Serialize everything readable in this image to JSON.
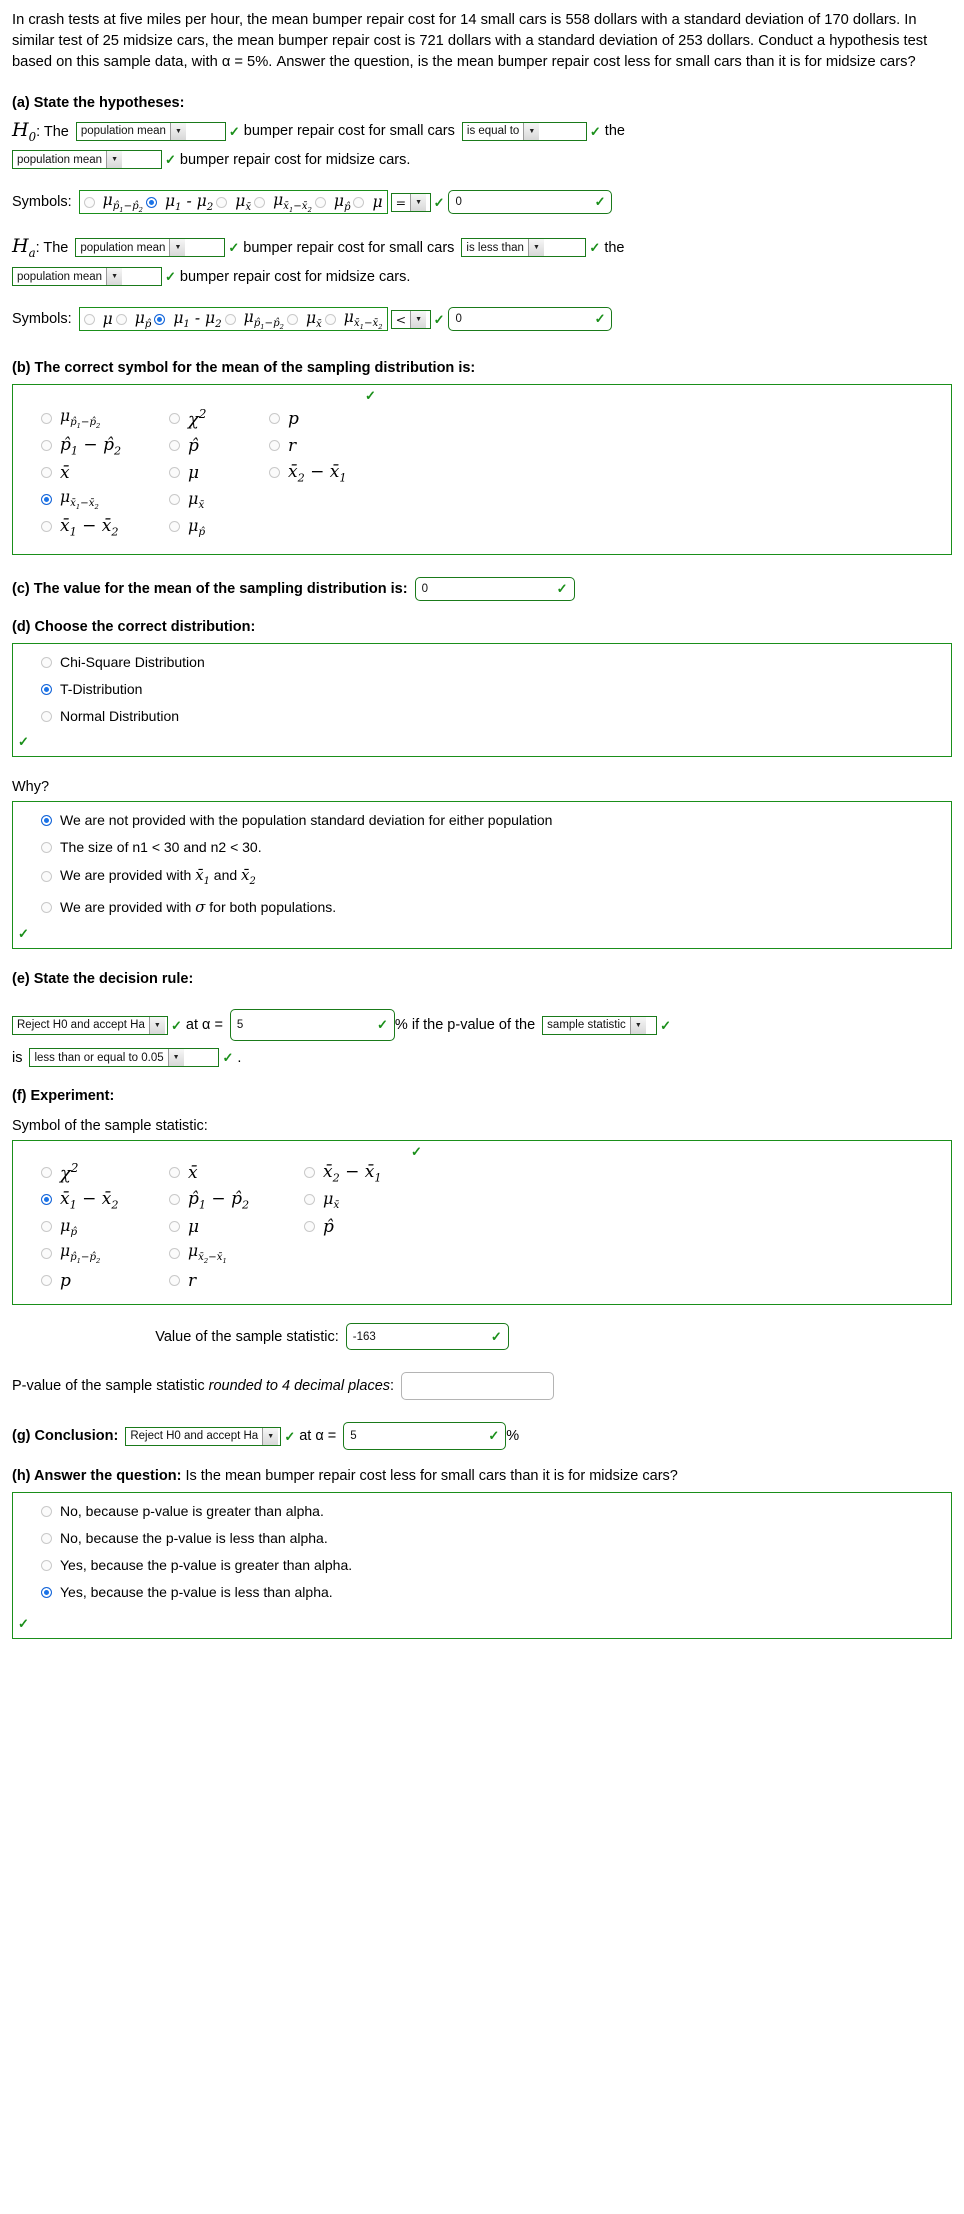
{
  "prompt": "In crash tests at five miles per hour, the mean bumper repair cost for 14 small cars is 558 dollars with a standard deviation of 170 dollars. In similar test of 25 midsize cars, the mean bumper repair cost is 721 dollars with a standard deviation of 253 dollars. Conduct a hypothesis test based on this sample data, with α = 5%. Answer the question, is the mean bumper repair cost less for small cars than it is for midsize cars?",
  "part_a": {
    "heading": "(a) State the hypotheses:",
    "h0": {
      "label": "H",
      "sub": "0",
      "the": ": The",
      "select1": "population mean",
      "mid_text": "bumper repair cost for small cars",
      "select2": "is equal to",
      "the_word": "the",
      "select3": "population mean",
      "tail_text": "bumper repair cost for midsize cars."
    },
    "h0_symbols": {
      "label": "Symbols:",
      "options": [
        {
          "kind": "mu_phat_diff",
          "selected": false
        },
        {
          "kind": "mu1_mu2",
          "selected": true
        },
        {
          "kind": "mu_xbar",
          "selected": false
        },
        {
          "kind": "mu_xbar_diff",
          "selected": false
        },
        {
          "kind": "mu_phat",
          "selected": false
        },
        {
          "kind": "mu",
          "selected": false
        }
      ],
      "operator": "=",
      "value": "0"
    },
    "ha": {
      "label": "H",
      "sub": "a",
      "the": ": The",
      "select1": "population mean",
      "mid_text": "bumper repair cost for small cars",
      "select2": "is less than",
      "the_word": "the",
      "select3": "population mean",
      "tail_text": "bumper repair cost for midsize cars."
    },
    "ha_symbols": {
      "label": "Symbols:",
      "options": [
        {
          "kind": "mu",
          "selected": false
        },
        {
          "kind": "mu_phat",
          "selected": false
        },
        {
          "kind": "mu1_mu2",
          "selected": true
        },
        {
          "kind": "mu_phat_diff",
          "selected": false
        },
        {
          "kind": "mu_xbar",
          "selected": false
        },
        {
          "kind": "mu_xbar_diff",
          "selected": false
        }
      ],
      "operator": "<",
      "value": "0"
    }
  },
  "part_b": {
    "heading": "(b) The correct symbol for the mean of the sampling distribution is:",
    "col1": [
      {
        "kind": "mu_phat_diff",
        "selected": false
      },
      {
        "kind": "phat1_phat2",
        "selected": false
      },
      {
        "kind": "xbar",
        "selected": false
      },
      {
        "kind": "mu_xbar_diff",
        "selected": true
      },
      {
        "kind": "xbar1_xbar2",
        "selected": false
      }
    ],
    "col2": [
      {
        "kind": "chi2",
        "selected": false
      },
      {
        "kind": "phat",
        "selected": false
      },
      {
        "kind": "mu",
        "selected": false
      },
      {
        "kind": "mu_xbar",
        "selected": false
      },
      {
        "kind": "mu_phat",
        "selected": false
      }
    ],
    "col3": [
      {
        "kind": "p",
        "selected": false
      },
      {
        "kind": "r",
        "selected": false
      },
      {
        "kind": "xbar2_xbar1",
        "selected": false
      }
    ]
  },
  "part_c": {
    "heading": "(c) The value for the mean of the sampling distribution is:",
    "value": "0"
  },
  "part_d": {
    "heading": "(d) Choose the correct distribution:",
    "options": [
      {
        "label": "Chi-Square Distribution",
        "selected": false
      },
      {
        "label": "T-Distribution",
        "selected": true
      },
      {
        "label": "Normal Distribution",
        "selected": false
      }
    ]
  },
  "why": {
    "heading": "Why?",
    "options": [
      {
        "kind": "text",
        "label": "We are not provided with the population standard deviation for either population",
        "selected": true
      },
      {
        "kind": "text",
        "label": "The size of n1 < 30 and n2 < 30.",
        "selected": false
      },
      {
        "kind": "xbar12",
        "label_pre": "We are provided with ",
        "label_post": " and ",
        "selected": false
      },
      {
        "kind": "sigma",
        "label_pre": "We are provided with ",
        "label_post": " for both populations.",
        "selected": false
      }
    ]
  },
  "part_e": {
    "heading": "(e) State the decision rule:",
    "select1": "Reject H0 and accept Ha",
    "at_alpha": "at α =",
    "alpha_value": "5",
    "pct_text": "% if the p-value of the",
    "select2": "sample statistic",
    "is_word": "is",
    "select3": "less than or equal to 0.05",
    "period": "."
  },
  "part_f": {
    "heading": "(f) Experiment:",
    "symbol_label": "Symbol of the sample statistic:",
    "col1": [
      {
        "kind": "chi2",
        "selected": false
      },
      {
        "kind": "xbar1_xbar2",
        "selected": true
      },
      {
        "kind": "mu_phat",
        "selected": false
      },
      {
        "kind": "mu_phat_diff",
        "selected": false
      },
      {
        "kind": "p",
        "selected": false
      }
    ],
    "col2": [
      {
        "kind": "xbar",
        "selected": false
      },
      {
        "kind": "phat1_phat2",
        "selected": false
      },
      {
        "kind": "mu",
        "selected": false
      },
      {
        "kind": "mu_xbar2_xbar1",
        "selected": false
      },
      {
        "kind": "r",
        "selected": false
      }
    ],
    "col3": [
      {
        "kind": "xbar2_xbar1",
        "selected": false
      },
      {
        "kind": "mu_xbar",
        "selected": false
      },
      {
        "kind": "phat",
        "selected": false
      }
    ],
    "stat_label": "Value of the sample statistic:",
    "stat_value": "-163",
    "pvalue_label_1": "P-value of the sample statistic ",
    "pvalue_label_em": "rounded to 4 decimal places",
    "pvalue_label_2": ":",
    "pvalue_value": ""
  },
  "part_g": {
    "heading": "(g) Conclusion:",
    "select1": "Reject H0 and accept Ha",
    "at_alpha": "at α =",
    "alpha_value": "5",
    "percent": "%"
  },
  "part_h": {
    "heading_bold": "(h) Answer the question:",
    "heading_rest": " Is the mean bumper repair cost less for small cars than it is for midsize cars?",
    "options": [
      {
        "label": "No, because p-value is greater than alpha.",
        "selected": false
      },
      {
        "label": "No, because the p-value is less than alpha.",
        "selected": false
      },
      {
        "label": "Yes, because the p-value is greater than alpha.",
        "selected": false
      },
      {
        "label": "Yes, because the p-value is less than alpha.",
        "selected": true
      }
    ]
  },
  "icons": {
    "check": "✓",
    "caret": "▼"
  },
  "colors": {
    "green_border": "#1a8f1a",
    "check_green": "#1a8f1a",
    "radio_blue": "#1a73e8"
  }
}
